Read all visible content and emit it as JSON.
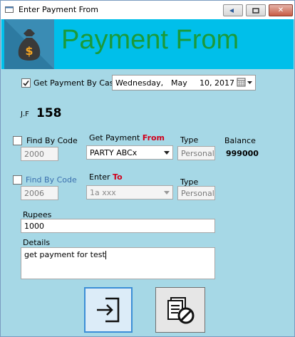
{
  "window": {
    "title": "Enter Payment From",
    "minimize_icon": "minimize-icon",
    "restore_icon": "restore-icon",
    "close_icon": "close-icon"
  },
  "banner": {
    "title": "Payment From",
    "logo_icon": "money-bag-icon"
  },
  "cash": {
    "label": "Get Payment By Cash",
    "checked": true,
    "date_weekday": "Wednesday,",
    "date_month": "May",
    "date_day_year": "10, 2017",
    "calendar_icon": "calendar-icon"
  },
  "jf": {
    "label": "J.F",
    "value": "158"
  },
  "from": {
    "find_label": "Find By Code",
    "code_value": "2000",
    "get_label": "Get Payment",
    "get_label_highlight": "From",
    "party_value": "PARTY ABCx",
    "type_label": "Type",
    "type_value": "Personal",
    "balance_label": "Balance",
    "balance_value": "999000"
  },
  "to": {
    "find_label": "Find By Code",
    "code_value": "2006",
    "enter_label": "Enter",
    "enter_label_highlight": "To",
    "account_value": "1a xxx",
    "type_label": "Type",
    "type_value": "Personal"
  },
  "rupees": {
    "label": "Rupees",
    "value": "1000"
  },
  "details": {
    "label": "Details",
    "value": "get payment for test"
  },
  "actions": {
    "save_icon": "enter-icon",
    "cancel_icon": "cancel-document-icon"
  },
  "colors": {
    "window_bg": "#a6d8e6",
    "banner_bg": "#00bfea",
    "banner_title": "#1a9a3a",
    "highlight_red": "#d0001c"
  }
}
